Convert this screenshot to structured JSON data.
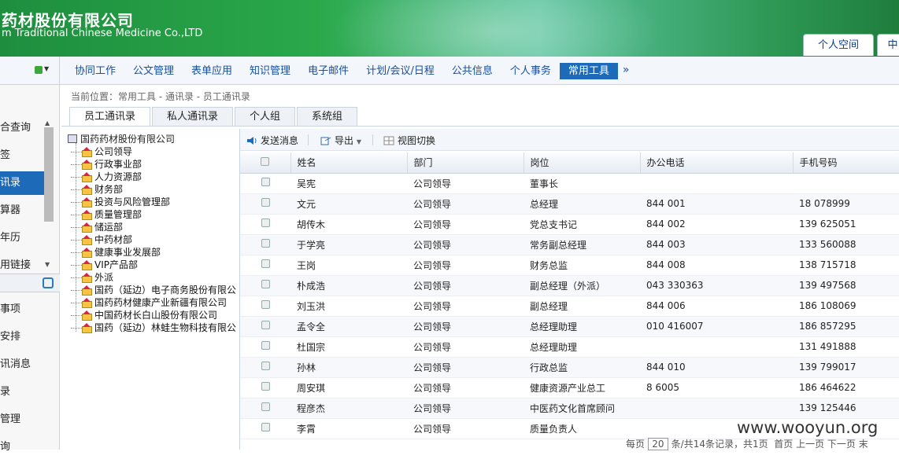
{
  "header": {
    "company_cn": "药材股份有限公司",
    "company_en": "m Traditional Chinese Medicine Co.,LTD",
    "tabs": [
      "个人空间",
      "中"
    ]
  },
  "nav": {
    "items": [
      "协同工作",
      "公文管理",
      "表单应用",
      "知识管理",
      "电子邮件",
      "计划/会议/日程",
      "公共信息",
      "个人事务",
      "常用工具"
    ],
    "active": "常用工具",
    "more": "»"
  },
  "sidebar": {
    "items": [
      "合查询",
      "签",
      "讯录",
      "算器",
      "年历",
      "用链接",
      "事项",
      "安排",
      "讯消息",
      "录",
      "管理",
      "询"
    ],
    "active_index": 2
  },
  "breadcrumb": "当前位置：常用工具 - 通讯录 - 员工通讯录",
  "tabs": [
    "员工通讯录",
    "私人通讯录",
    "个人组",
    "系统组"
  ],
  "tree": {
    "root": "国药药材股份有限公司",
    "nodes": [
      "公司领导",
      "行政事业部",
      "人力资源部",
      "财务部",
      "投资与风险管理部",
      "质量管理部",
      "储运部",
      "中药材部",
      "健康事业发展部",
      "VIP产品部",
      "外派",
      "国药（延边）电子商务股份有限公",
      "国药药材健康产业新疆有限公司",
      "中国药材长白山股份有限公司",
      "国药（延边）林蛙生物科技有限公"
    ]
  },
  "toolbar": {
    "send": "发送消息",
    "export": "导出",
    "view": "视图切换"
  },
  "table": {
    "columns": [
      "姓名",
      "部门",
      "岗位",
      "办公电话",
      "手机号码"
    ],
    "rows": [
      [
        "吴宪",
        "公司领导",
        "董事长",
        "",
        ""
      ],
      [
        "文元",
        "公司领导",
        "总经理",
        "844 001",
        "18 078999"
      ],
      [
        "胡传木",
        "公司领导",
        "党总支书记",
        "844 002",
        "139 625051"
      ],
      [
        "于学亮",
        "公司领导",
        "常务副总经理",
        "844 003",
        "133 560088"
      ],
      [
        "王岗",
        "公司领导",
        "财务总监",
        "844 008",
        "138 715718"
      ],
      [
        "朴成浩",
        "公司领导",
        "副总经理（外派）",
        "043 330363",
        "139 497568"
      ],
      [
        "刘玉洪",
        "公司领导",
        "副总经理",
        "844 006",
        "186 108069"
      ],
      [
        "孟令全",
        "公司领导",
        "总经理助理",
        "010 416007",
        "186 857295"
      ],
      [
        "杜国宗",
        "公司领导",
        "总经理助理",
        "",
        "131 491888"
      ],
      [
        "孙林",
        "公司领导",
        "行政总监",
        "844 010",
        "139 799017"
      ],
      [
        "周安琪",
        "公司领导",
        "健康资源产业总工",
        "8 6005",
        "186 464622"
      ],
      [
        "程彦杰",
        "公司领导",
        "中医药文化首席顾问",
        "",
        "139 125446"
      ],
      [
        "李霄",
        "公司领导",
        "质量负责人",
        "",
        ""
      ]
    ]
  },
  "pager": {
    "text1": "每页",
    "page_size": "20",
    "text2": "条/共14条记录，共1页",
    "nav": "首页 上一页 下一页 末"
  },
  "watermark": "www.wooyun.org"
}
